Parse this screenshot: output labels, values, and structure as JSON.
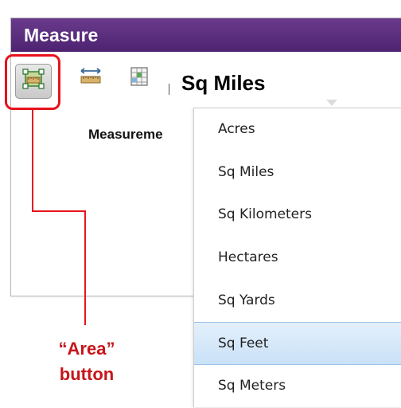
{
  "window": {
    "title": "Measure"
  },
  "toolbar": {
    "area_tool": {
      "icon": "area-ruler-icon"
    },
    "distance_tool": {
      "icon": "distance-ruler-icon"
    },
    "location_tool": {
      "icon": "location-grid-icon"
    },
    "unit_selected": "Sq Miles",
    "unit_caret": "chevron-down-icon"
  },
  "measurement_label": "Measureme",
  "units_menu": {
    "options": [
      "Acres",
      "Sq Miles",
      "Sq Kilometers",
      "Hectares",
      "Sq Yards",
      "Sq Feet",
      "Sq Meters"
    ],
    "highlighted": "Sq Feet"
  },
  "annotation": {
    "line1": "“Area”",
    "line2": "button",
    "color": "#e8131c"
  },
  "colors": {
    "titlebar": "#5a2d7d",
    "highlight": "#c9e1f7",
    "callout_red": "#e8131c"
  }
}
